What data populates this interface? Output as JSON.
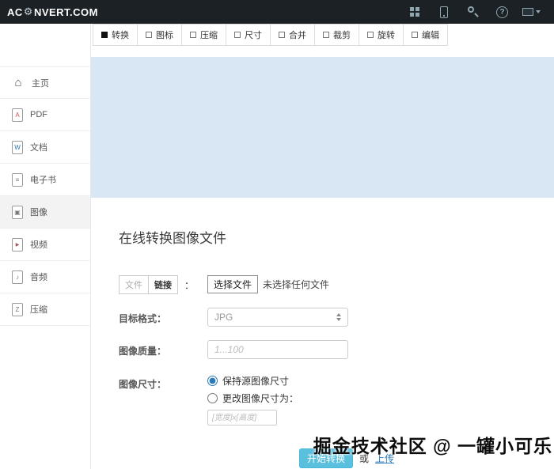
{
  "topbar": {
    "logo_prefix": "AC",
    "gear_glyph": "⚙",
    "logo_suffix": "NVERT.COM",
    "help_glyph": "?",
    "icon_names": [
      "apps-grid",
      "mobile-device",
      "search",
      "help",
      "language-flag"
    ]
  },
  "sidebar": {
    "items": [
      {
        "label": "主页",
        "icon": "home",
        "glyph": "⌂"
      },
      {
        "label": "PDF",
        "icon": "pdf-file",
        "glyph": "A"
      },
      {
        "label": "文档",
        "icon": "word-document",
        "glyph": "W"
      },
      {
        "label": "电子书",
        "icon": "ebook",
        "glyph": "≡"
      },
      {
        "label": "图像",
        "icon": "image-file",
        "glyph": "▣",
        "active": true
      },
      {
        "label": "视频",
        "icon": "video-file",
        "glyph": "▶"
      },
      {
        "label": "音频",
        "icon": "audio-file",
        "glyph": "♪"
      },
      {
        "label": "压缩",
        "icon": "archive-file",
        "glyph": "Z"
      }
    ]
  },
  "tabs": [
    {
      "label": "转换",
      "active": true
    },
    {
      "label": "图标"
    },
    {
      "label": "压缩"
    },
    {
      "label": "尺寸"
    },
    {
      "label": "合并"
    },
    {
      "label": "裁剪"
    },
    {
      "label": "旋转"
    },
    {
      "label": "编辑"
    }
  ],
  "main": {
    "heading": "在线转换图像文件",
    "source": {
      "file_tab": "文件",
      "link_tab": "链接",
      "colon": "：",
      "choose_button": "选择文件",
      "status": "未选择任何文件"
    },
    "format": {
      "label": "目标格式：",
      "value": "JPG"
    },
    "quality": {
      "label": "图像质量：",
      "placeholder": "1...100"
    },
    "size": {
      "label": "图像尺寸：",
      "keep_option": "保持源图像尺寸",
      "change_option": "更改图像尺寸为：",
      "placeholder": "[宽度]x[高度]"
    },
    "submit": {
      "button": "开始转换",
      "or_text": "或",
      "link": "上传"
    }
  },
  "watermark": "掘金技术社区 @ 一罐小可乐",
  "colors": {
    "topbar_bg": "#1b2125",
    "banner_bg": "#d8e7f3",
    "accent_blue": "#5bc0de",
    "link_blue": "#2a7ab9"
  }
}
